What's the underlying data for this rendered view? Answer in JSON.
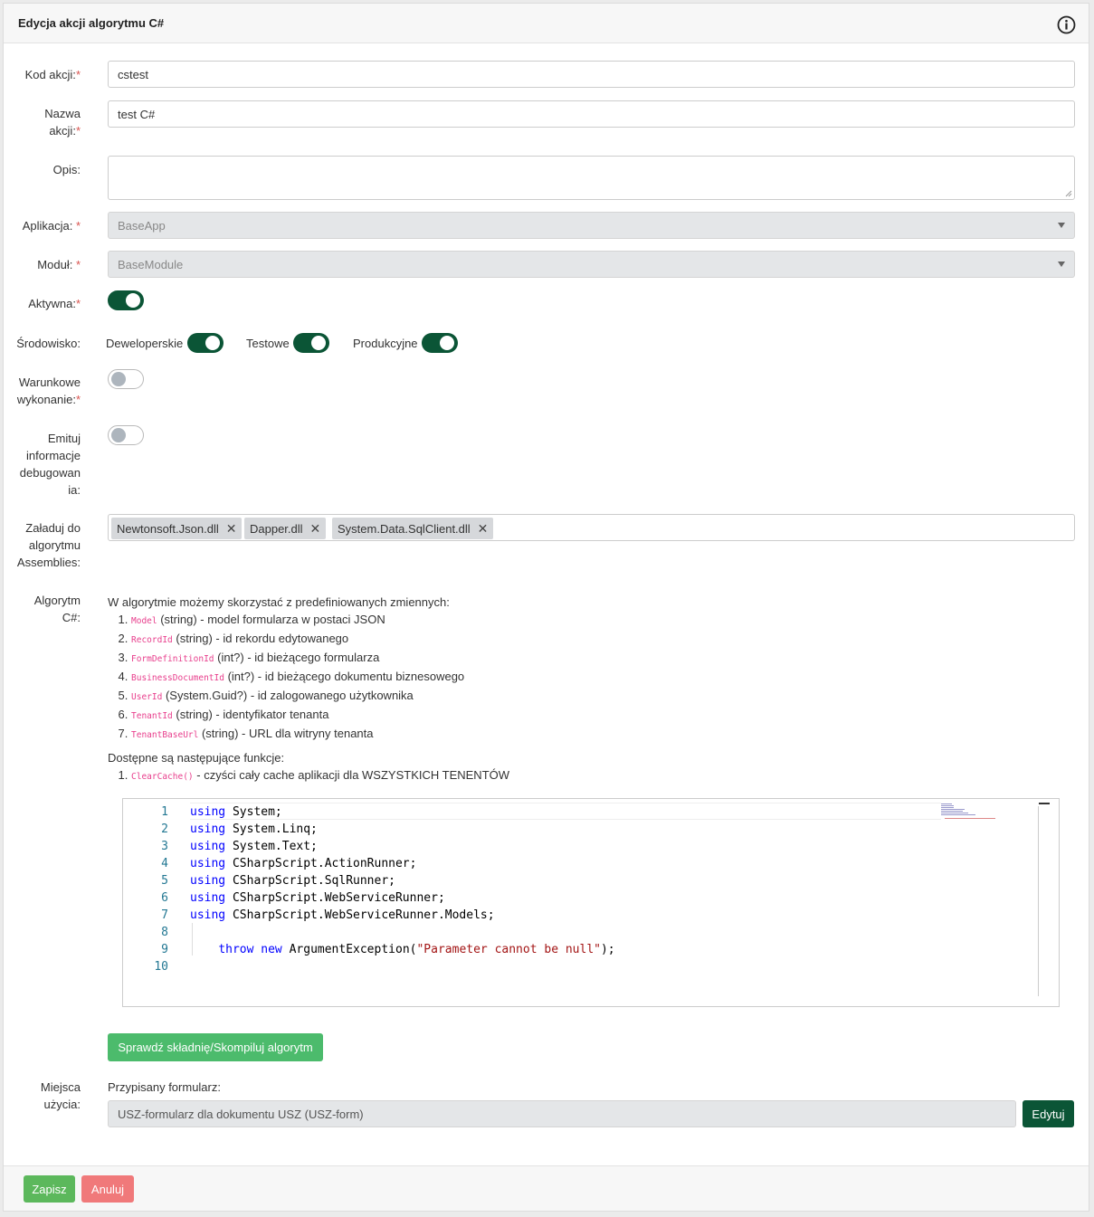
{
  "header": {
    "title": "Edycja akcji algorytmu C#",
    "info_icon": "info-circle-icon"
  },
  "form": {
    "kod": {
      "label": "Kod akcji:",
      "required": "*",
      "value": "cstest"
    },
    "nazwa": {
      "label_line1": "Nazwa",
      "label_line2": "akcji:",
      "required": "*",
      "value": "test C#"
    },
    "opis": {
      "label": "Opis:",
      "value": ""
    },
    "aplikacja": {
      "label": "Aplikacja: ",
      "required": "*",
      "value": "BaseApp"
    },
    "modul": {
      "label": "Moduł: ",
      "required": "*",
      "value": "BaseModule"
    },
    "aktywna": {
      "label": "Aktywna:",
      "required": "*",
      "on": true
    },
    "srodowisko": {
      "label": "Środowisko:",
      "envs": [
        {
          "label": "Deweloperskie",
          "on": true
        },
        {
          "label": "Testowe",
          "on": true
        },
        {
          "label": "Produkcyjne",
          "on": true
        }
      ]
    },
    "warunkowe": {
      "label_line1": "Warunkowe",
      "label_line2": "wykonanie:",
      "required": "*",
      "on": false
    },
    "emituj": {
      "label_lines": [
        "Emituj",
        "informacje",
        "debugowan",
        "ia:"
      ],
      "on": false
    },
    "assemblies": {
      "label_lines": [
        "Załaduj do",
        "algorytmu",
        "Assemblies:"
      ],
      "tags": [
        "Newtonsoft.Json.dll",
        "Dapper.dll",
        "System.Data.SqlClient.dll"
      ],
      "remove_glyph": "✕"
    },
    "algorytm": {
      "label_line1": "Algorytm",
      "label_line2": "C#:",
      "intro": "W algorytmie możemy skorzystać z predefiniowanych zmiennych:",
      "variables": [
        {
          "code": "Model",
          "desc": " (string) - model formularza w postaci JSON"
        },
        {
          "code": "RecordId",
          "desc": " (string) - id rekordu edytowanego"
        },
        {
          "code": "FormDefinitionId",
          "desc": " (int?) - id bieżącego formularza"
        },
        {
          "code": "BusinessDocumentId",
          "desc": " (int?) - id bieżącego dokumentu biznesowego"
        },
        {
          "code": "UserId",
          "desc": " (System.Guid?) - id zalogowanego użytkownika"
        },
        {
          "code": "TenantId",
          "desc": " (string) - identyfikator tenanta"
        },
        {
          "code": "TenantBaseUrl",
          "desc": " (string) - URL dla witryny tenanta"
        }
      ],
      "functions_intro": "Dostępne są następujące funkcje:",
      "functions": [
        {
          "code": "ClearCache()",
          "desc": " - czyści cały cache aplikacji dla WSZYSTKICH TENENTÓW"
        }
      ]
    },
    "code_lines": [
      {
        "n": "1",
        "kw": "using",
        "rest": " System;",
        "indent": "",
        "kw2": "",
        "str": "",
        "tail": ""
      },
      {
        "n": "2",
        "kw": "using",
        "rest": " System.Linq;",
        "indent": "",
        "kw2": "",
        "str": "",
        "tail": ""
      },
      {
        "n": "3",
        "kw": "using",
        "rest": " System.Text;",
        "indent": "",
        "kw2": "",
        "str": "",
        "tail": ""
      },
      {
        "n": "4",
        "kw": "using",
        "rest": " CSharpScript.ActionRunner;",
        "indent": "",
        "kw2": "",
        "str": "",
        "tail": ""
      },
      {
        "n": "5",
        "kw": "using",
        "rest": " CSharpScript.SqlRunner;",
        "indent": "",
        "kw2": "",
        "str": "",
        "tail": ""
      },
      {
        "n": "6",
        "kw": "using",
        "rest": " CSharpScript.WebServiceRunner;",
        "indent": "",
        "kw2": "",
        "str": "",
        "tail": ""
      },
      {
        "n": "7",
        "kw": "using",
        "rest": " CSharpScript.WebServiceRunner.Models;",
        "indent": "",
        "kw2": "",
        "str": "",
        "tail": ""
      },
      {
        "n": "8",
        "kw": "",
        "rest": "",
        "indent": "",
        "kw2": "",
        "str": "",
        "tail": ""
      },
      {
        "n": "9",
        "kw": "",
        "rest": "",
        "indent": "    ",
        "kw2": "throw new",
        "str": "\"Parameter cannot be null\"",
        "tail": ");",
        "mid": " ArgumentException("
      },
      {
        "n": "10",
        "kw": "",
        "rest": "",
        "indent": "",
        "kw2": "",
        "str": "",
        "tail": ""
      }
    ],
    "compile_button": "Sprawdź składnię/Skompiluj algorytm",
    "miejsca": {
      "label_line1": "Miejsca",
      "label_line2": "użycia:",
      "assigned_label": "Przypisany formularz:",
      "assigned_value": "USZ-formularz dla dokumentu USZ (USZ-form)",
      "edit_button": "Edytuj"
    }
  },
  "footer": {
    "save": "Zapisz",
    "cancel": "Anuluj"
  },
  "colors": {
    "toggle_on": "#0b5536",
    "save": "#5cb85c",
    "cancel": "#f0797a",
    "compile": "#4cbb6c",
    "edit": "#0b5536"
  }
}
